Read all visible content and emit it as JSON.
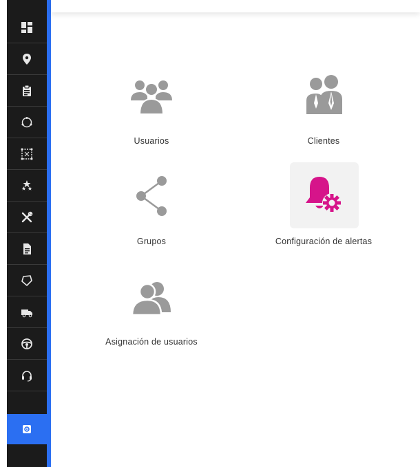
{
  "sidebar": {
    "items": [
      {
        "icon": "dashboard-icon"
      },
      {
        "icon": "location-pin-icon"
      },
      {
        "icon": "clipboard-icon"
      },
      {
        "icon": "circle-route-icon"
      },
      {
        "icon": "geofence-icon"
      },
      {
        "icon": "stars-icon"
      },
      {
        "icon": "tools-icon"
      },
      {
        "icon": "document-icon"
      },
      {
        "icon": "shield-icon"
      },
      {
        "icon": "truck-icon"
      },
      {
        "icon": "steering-wheel-icon"
      },
      {
        "icon": "headset-icon"
      },
      {
        "icon": "settings-icon",
        "active": true
      }
    ],
    "accent_color": "#2b6ff2"
  },
  "modules": [
    {
      "label": "Usuarios",
      "icon": "users-icon"
    },
    {
      "label": "Clientes",
      "icon": "clients-icon"
    },
    {
      "label": "Grupos",
      "icon": "groups-share-icon"
    },
    {
      "label": "Configuración de alertas",
      "icon": "alert-settings-icon",
      "highlighted": true
    },
    {
      "label": "Asignación de usuarios",
      "icon": "user-assignment-icon"
    }
  ],
  "colors": {
    "icon_gray": "#9a9a9a",
    "alert_magenta": "#d6148a"
  }
}
